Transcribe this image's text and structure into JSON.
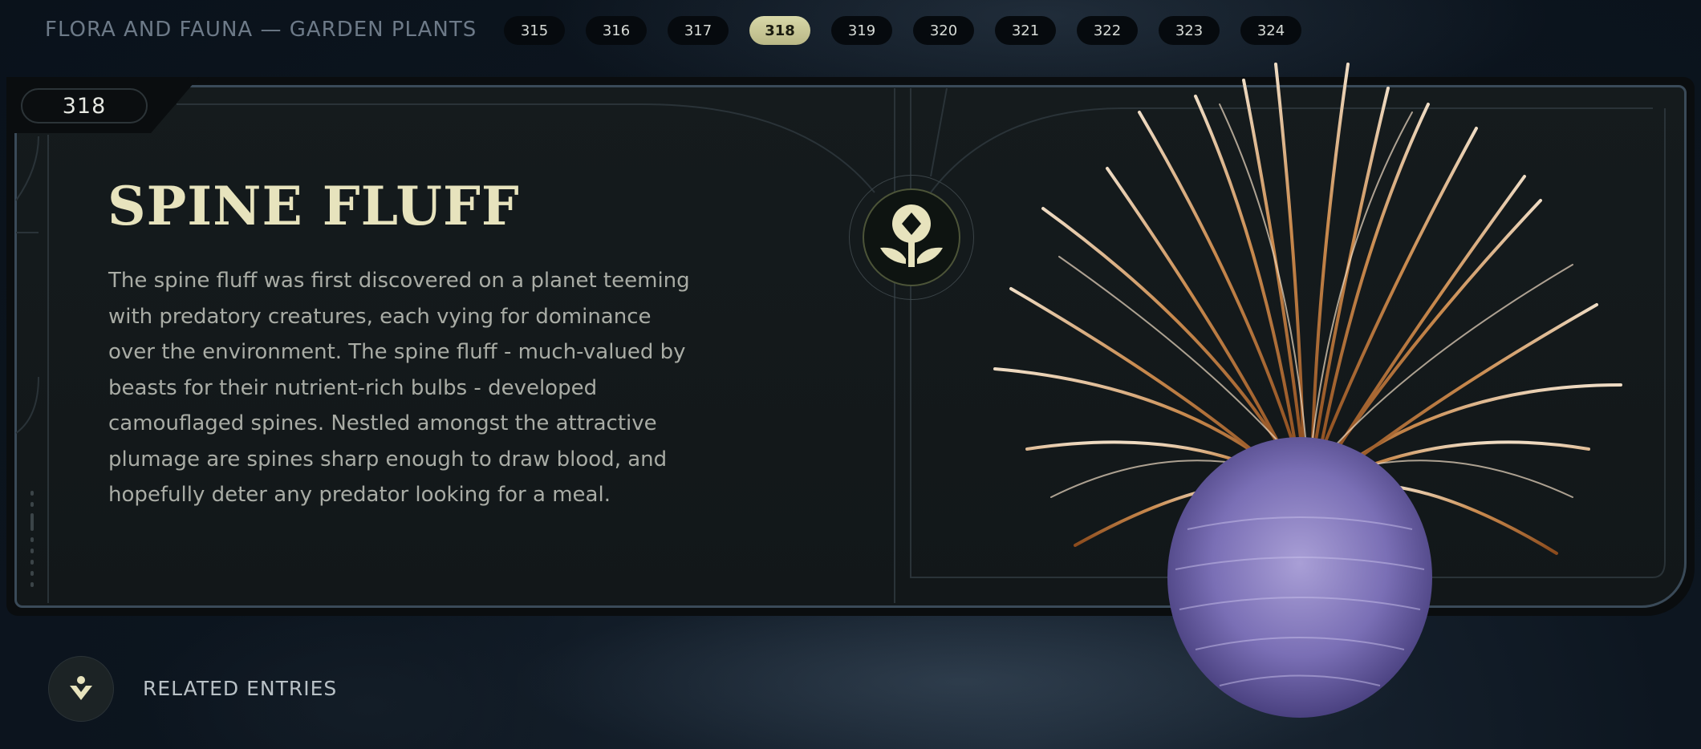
{
  "header": {
    "section_title": "FLORA AND FAUNA — GARDEN PLANTS",
    "pages": [
      "315",
      "316",
      "317",
      "318",
      "319",
      "320",
      "321",
      "322",
      "323",
      "324"
    ],
    "active_page": "318"
  },
  "entry": {
    "number": "318",
    "title": "SPINE FLUFF",
    "description": "The spine fluff was first discovered on a planet teeming with predatory creatures, each vying for dominance over the environment. The spine fluff - much-valued by beasts for their nutrient-rich bulbs - developed camouflaged spines. Nestled amongst the attractive plumage are spines sharp enough to draw blood, and hopefully deter any predator looking for a meal.",
    "category_icon": "flower-icon",
    "image": "spine-fluff-plant"
  },
  "footer": {
    "related_label": "RELATED ENTRIES",
    "related_icon": "person-down-icon"
  },
  "colors": {
    "accent": "#e7e3bd",
    "active_pill": "#cfcd9a",
    "panel_border": "#3a4a58"
  }
}
